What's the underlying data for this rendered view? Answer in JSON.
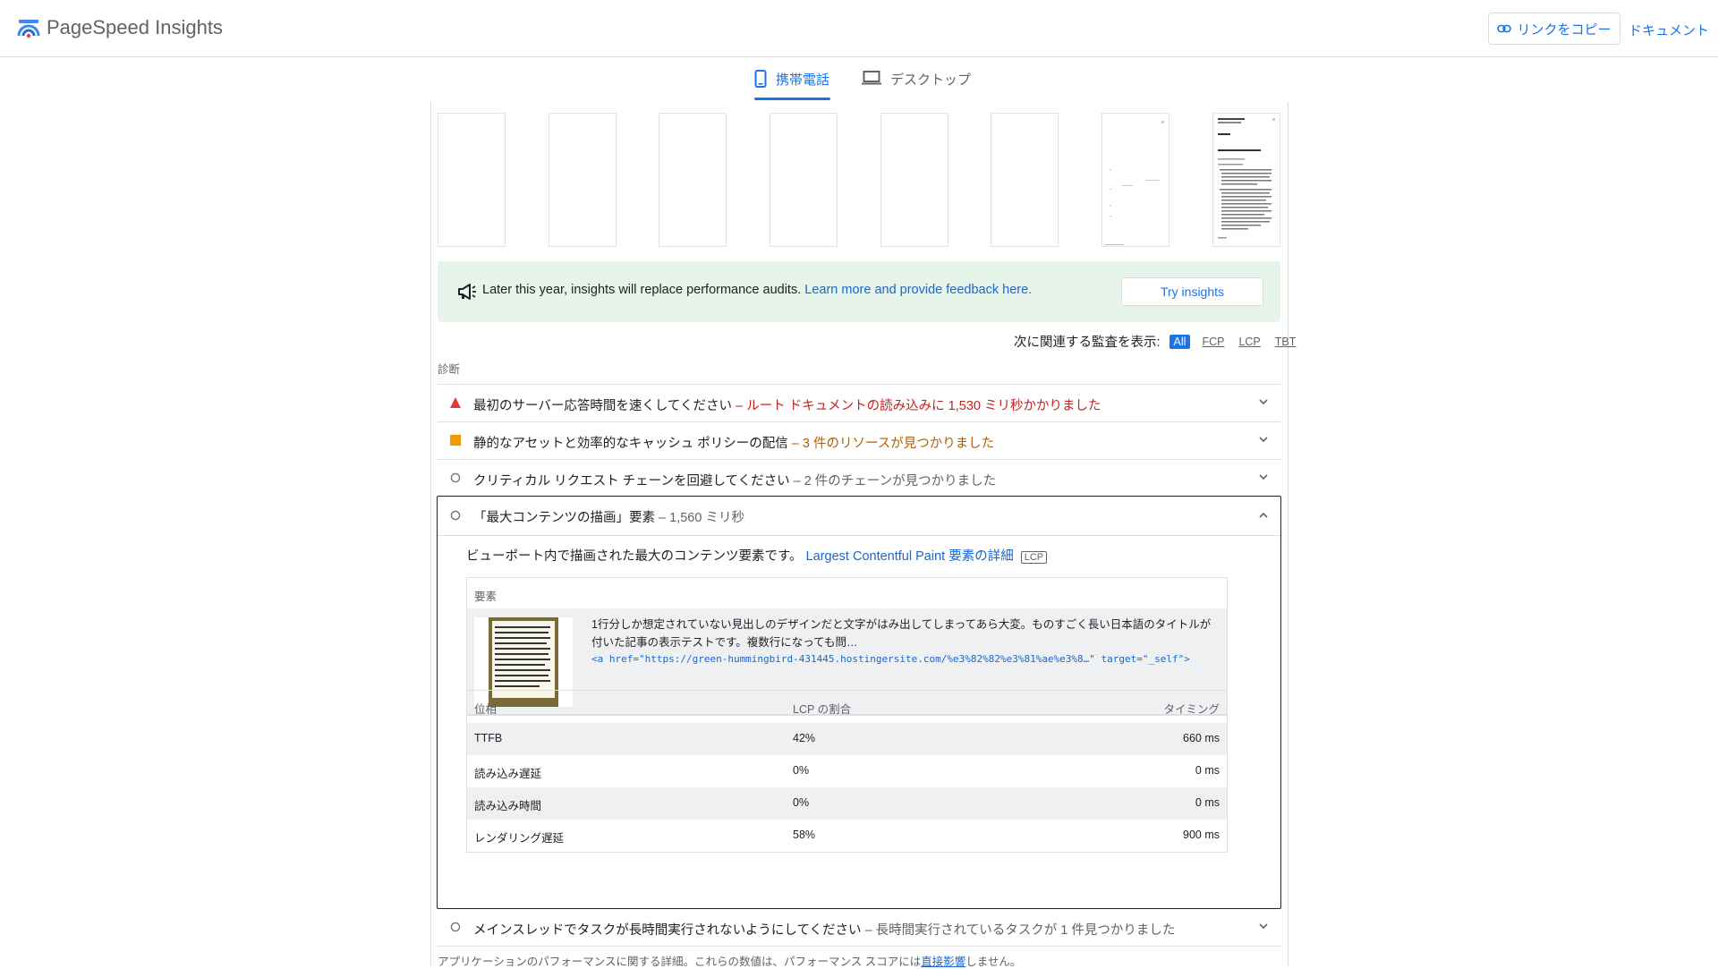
{
  "header": {
    "app_title": "PageSpeed Insights",
    "copy_link_label": "リンクをコピー",
    "docs_label": "ドキュメント"
  },
  "tabs": [
    {
      "label": "携帯電話",
      "icon": "smartphone-icon",
      "active": true
    },
    {
      "label": "デスクトップ",
      "icon": "laptop-icon",
      "active": false
    }
  ],
  "banner": {
    "text": "Later this year, insights will replace performance audits.",
    "link": "Learn more and provide feedback here.",
    "button": "Try insights",
    "icon": "megaphone-icon"
  },
  "filter": {
    "label": "次に関連する監査を表示:",
    "options": [
      "All",
      "FCP",
      "LCP",
      "TBT"
    ],
    "selected": "All"
  },
  "section_label": "診断",
  "audits": [
    {
      "title": "最初のサーバー応答時間を速くしてください",
      "detail": "– ルート ドキュメントの読み込みに 1,530 ミリ秒かかりました",
      "status": "fail"
    },
    {
      "title": "静的なアセットと効率的なキャッシュ ポリシーの配信",
      "detail": "– 3 件のリソースが見つかりました",
      "status": "average"
    },
    {
      "title": "クリティカル リクエスト チェーンを回避してください",
      "detail": "– 2 件のチェーンが見つかりました",
      "status": "info"
    }
  ],
  "expanded_audit": {
    "title": "「最大コンテンツの描画」要素",
    "detail": "– 1,560 ミリ秒",
    "description": "ビューポート内で描画された最大のコンテンツ要素です。",
    "link": "Largest Contentful Paint 要素の詳細",
    "tag": "LCP",
    "element_header": "要素",
    "element_text": "1行分しか想定されていない見出しのデザインだと文字がはみ出してしまってあら大変。ものすごく長い日本語のタイトルが付いた記事の表示テストです。複数行になっても問…",
    "element_code": "<a href=\"https://green-hummingbird-431445.hostingersite.com/%e3%82%82%e3%81%ae%e3%8…\" target=\"_self\">",
    "phase_headers": [
      "位相",
      "LCP の割合",
      "タイミング"
    ],
    "phases": [
      {
        "name": "TTFB",
        "percent": "42%",
        "timing": "660 ms"
      },
      {
        "name": "読み込み遅延",
        "percent": "0%",
        "timing": "0 ms"
      },
      {
        "name": "読み込み時間",
        "percent": "0%",
        "timing": "0 ms"
      },
      {
        "name": "レンダリング遅延",
        "percent": "58%",
        "timing": "900 ms"
      }
    ]
  },
  "last_audit": {
    "title": "メインスレッドでタスクが長時間実行されないようにしてください",
    "detail": "– 長時間実行されているタスクが 1 件見つかりました",
    "status": "info"
  },
  "footer_note": {
    "text_before": "アプリケーションのパフォーマンスに関する詳細。これらの数値は、パフォーマンス スコアには",
    "link": "直接影響",
    "text_after": "しません。"
  },
  "colors": {
    "accent": "#1a73e8",
    "fail": "#c5221f",
    "average": "#b06000",
    "info": "#5f6368",
    "banner_bg": "#e6f4ea"
  }
}
